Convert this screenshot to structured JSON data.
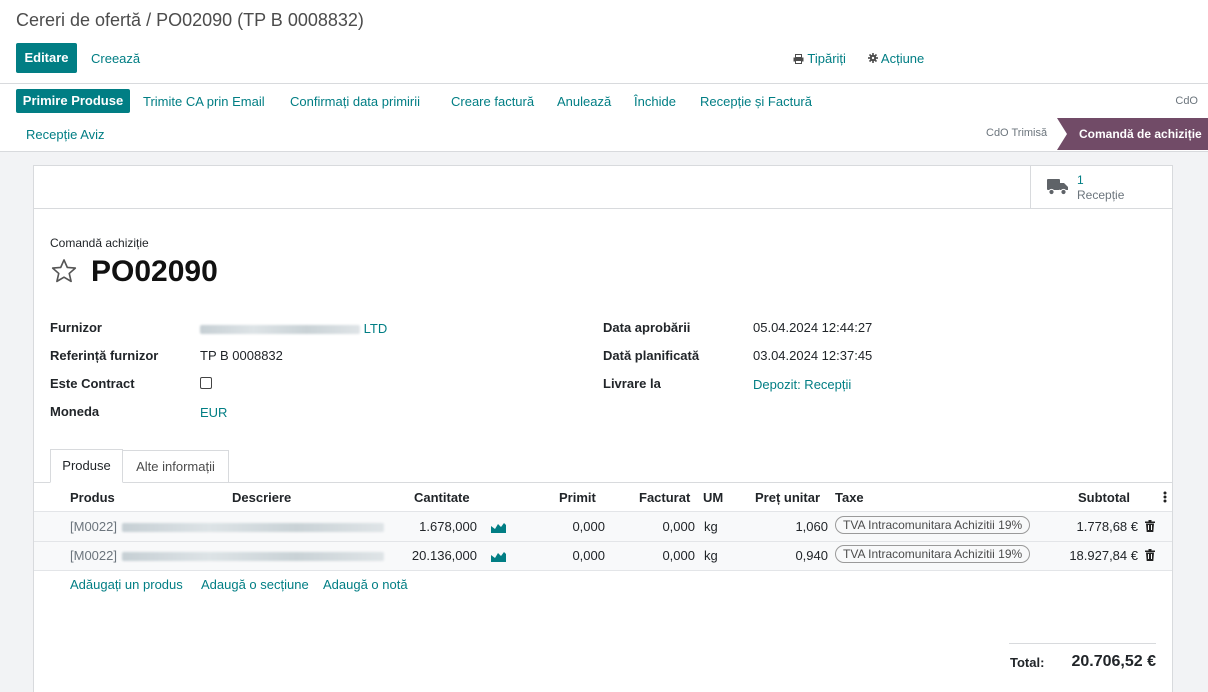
{
  "breadcrumb": {
    "parent": "Cereri de ofertă",
    "separator": " / ",
    "current": "PO02090 (TP B 0008832)"
  },
  "control": {
    "edit": "Editare",
    "create": "Creează",
    "print": "Tipăriți",
    "action": "Acțiune"
  },
  "statusbar": {
    "buttons": [
      "Primire Produse",
      "Trimite CA prin Email",
      "Confirmați data primirii",
      "Creare factură",
      "Anulează",
      "Închide",
      "Recepție și Factură",
      "Recepție Aviz"
    ],
    "tag": "CdO",
    "stages": [
      "CdO Trimisă",
      "Comandă de achiziție"
    ]
  },
  "smart_button": {
    "value": "1",
    "label": "Recepție"
  },
  "form": {
    "title_label": "Comandă achiziție",
    "name": "PO02090",
    "left": {
      "supplier_label": "Furnizor",
      "supplier_suffix": "LTD",
      "ref_label": "Referință furnizor",
      "ref_value": "TP B 0008832",
      "contract_label": "Este Contract",
      "currency_label": "Moneda",
      "currency_value": "EUR"
    },
    "right": {
      "approve_label": "Data aprobării",
      "approve_value": "05.04.2024 12:44:27",
      "planned_label": "Dată planificată",
      "planned_value": "03.04.2024 12:37:45",
      "deliver_label": "Livrare la",
      "deliver_value": "Depozit: Recepții"
    }
  },
  "tabs": [
    "Produse",
    "Alte informații"
  ],
  "table": {
    "headers": [
      "Produs",
      "Descriere",
      "Cantitate",
      "Primit",
      "Facturat",
      "UM",
      "Preț unitar",
      "Taxe",
      "Subtotal"
    ],
    "rows": [
      {
        "product": "[M0022]",
        "qty": "1.678,000",
        "received": "0,000",
        "billed": "0,000",
        "uom": "kg",
        "price": "1,060",
        "tax": "TVA Intracomunitara Achizitii 19%",
        "subtotal": "1.778,68 €"
      },
      {
        "product": "[M0022]",
        "qty": "20.136,000",
        "received": "0,000",
        "billed": "0,000",
        "uom": "kg",
        "price": "0,940",
        "tax": "TVA Intracomunitara Achizitii 19%",
        "subtotal": "18.927,84 €"
      }
    ],
    "add_links": [
      "Adăugați un produs",
      "Adaugă o secțiune",
      "Adaugă o notă"
    ]
  },
  "total": {
    "label": "Total:",
    "value": "20.706,52 €"
  },
  "colors": {
    "teal": "#017e84",
    "stage_active": "#714b67"
  }
}
